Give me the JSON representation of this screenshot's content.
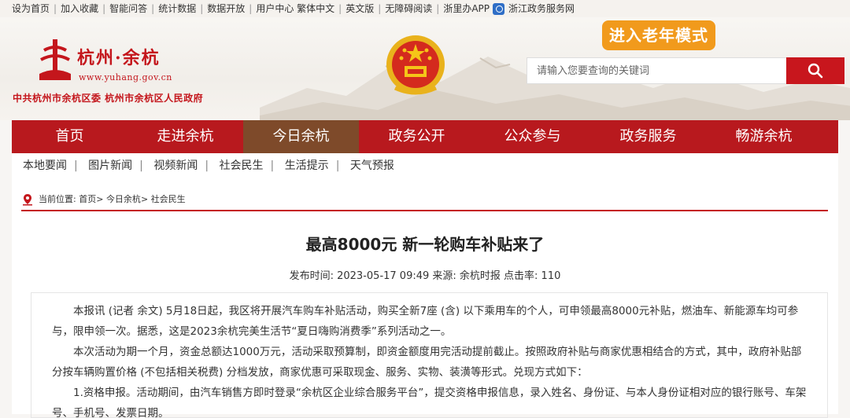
{
  "topbar": {
    "links": [
      "设为首页",
      "加入收藏",
      "智能问答",
      "统计数据",
      "数据开放",
      "用户中心",
      "繁体中文",
      "英文版",
      "无障碍阅读",
      "浙里办APP"
    ],
    "zwfw_label": "浙江政务服务网"
  },
  "header": {
    "logo_title": "杭州·余杭",
    "logo_url": "www.yuhang.gov.cn",
    "org_name": "中共杭州市余杭区委  杭州市余杭区人民政府",
    "elder_mode": "进入老年模式",
    "search_placeholder": "请输入您要查询的关键词"
  },
  "nav": {
    "items": [
      "首页",
      "走进余杭",
      "今日余杭",
      "政务公开",
      "公众参与",
      "政务服务",
      "畅游余杭"
    ],
    "active": "今日余杭"
  },
  "subnav": {
    "items": [
      "本地要闻",
      "图片新闻",
      "视频新闻",
      "社会民生",
      "生活提示",
      "天气预报"
    ]
  },
  "breadcrumb": {
    "label": "当前位置:",
    "items": [
      "首页",
      "今日余杭",
      "社会民生"
    ]
  },
  "article": {
    "title": "最高8000元 新一轮购车补贴来了",
    "meta": "发布时间: 2023-05-17 09:49 来源: 余杭时报 点击率: 110",
    "paragraphs": [
      "本报讯 (记者 余文) 5月18日起，我区将开展汽车购车补贴活动，购买全新7座 (含) 以下乘用车的个人，可申领最高8000元补贴，燃油车、新能源车均可参与，限申领一次。据悉，这是2023余杭完美生活节“夏日嗨购消费季”系列活动之一。",
      "本次活动为期一个月，资金总额达1000万元，活动采取预算制，即资金额度用完活动提前截止。按照政府补贴与商家优惠相结合的方式，其中，政府补贴部分按车辆购置价格 (不包括相关税费) 分档发放，商家优惠可采取现金、服务、实物、装潢等形式。兑现方式如下：",
      "1.资格申报。活动期间，由汽车销售方即时登录“余杭区企业综合服务平台”，提交资格申报信息，录入姓名、身份证、与本人身份证相对应的银行账号、车架号、手机号、发票日期。"
    ]
  },
  "colors": {
    "brand_red": "#c4161c",
    "nav_red": "#b8191e",
    "nav_active": "#7e4a2a",
    "elder_orange": "#f19a1c"
  }
}
